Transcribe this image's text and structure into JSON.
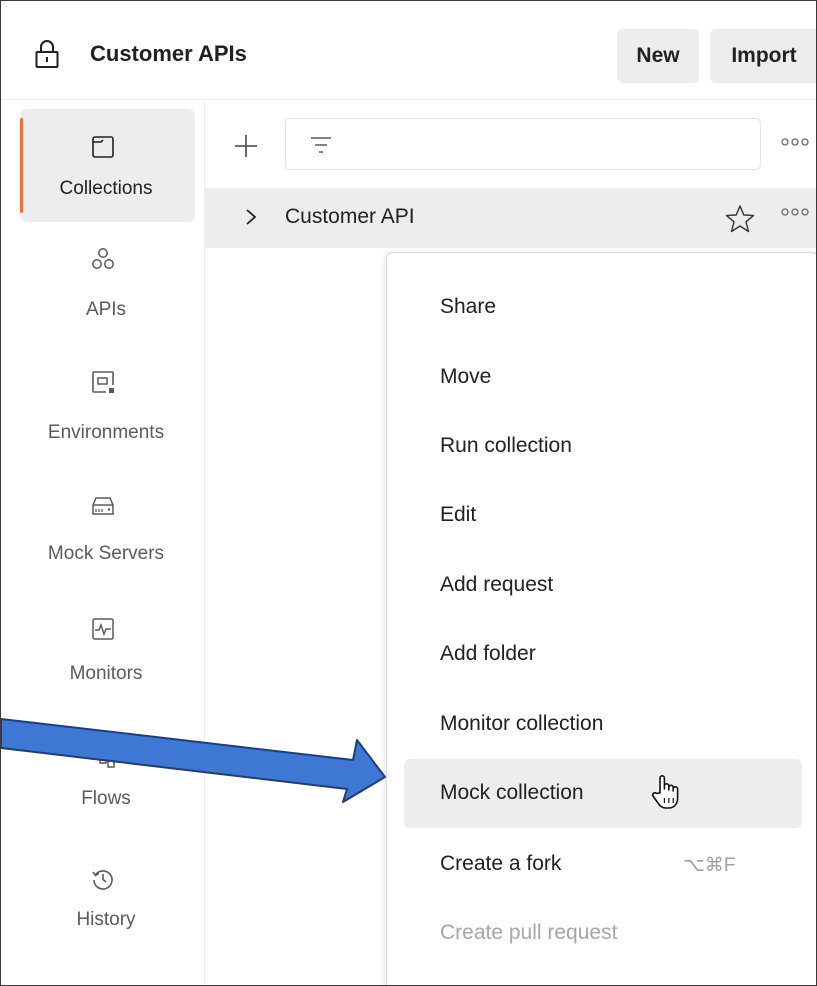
{
  "header": {
    "workspace_icon": "lock-icon",
    "workspace_title": "Customer APIs",
    "new_label": "New",
    "import_label": "Import"
  },
  "sidebar": {
    "items": [
      {
        "label": "Collections",
        "icon": "collections-icon",
        "active": true
      },
      {
        "label": "APIs",
        "icon": "apis-icon"
      },
      {
        "label": "Environments",
        "icon": "environments-icon"
      },
      {
        "label": "Mock Servers",
        "icon": "mock-servers-icon"
      },
      {
        "label": "Monitors",
        "icon": "monitors-icon"
      },
      {
        "label": "Flows",
        "icon": "flows-icon"
      },
      {
        "label": "History",
        "icon": "history-icon"
      }
    ]
  },
  "collections": {
    "items": [
      {
        "name": "Customer API"
      }
    ]
  },
  "menu": {
    "items": [
      {
        "label": "Share"
      },
      {
        "label": "Move"
      },
      {
        "label": "Run collection"
      },
      {
        "label": "Edit"
      },
      {
        "label": "Add request"
      },
      {
        "label": "Add folder"
      },
      {
        "label": "Monitor collection"
      },
      {
        "label": "Mock collection",
        "hovered": true
      },
      {
        "label": "Create a fork",
        "shortcut": "⌥⌘F"
      },
      {
        "label": "Create pull request",
        "disabled": true
      }
    ]
  },
  "colors": {
    "accent": "#f26b3a",
    "annotation_arrow": "#3e78d4"
  }
}
